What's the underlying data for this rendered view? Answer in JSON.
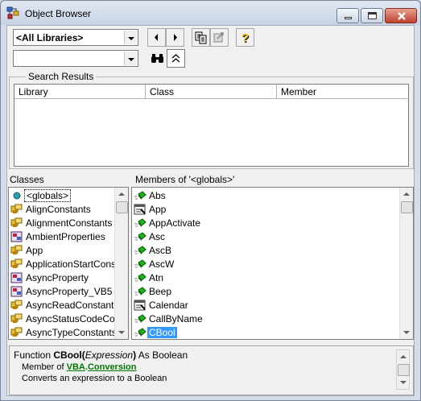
{
  "window": {
    "title": "Object Browser"
  },
  "toolbar": {
    "library_combo": "<All Libraries>",
    "search_combo": "",
    "buttons": [
      "back-icon",
      "forward-icon",
      "copy-icon",
      "view-definition-icon",
      "help-icon",
      "search-binoculars-icon",
      "collapse-results-icon"
    ]
  },
  "search_results": {
    "label": "Search Results",
    "columns": [
      "Library",
      "Class",
      "Member"
    ]
  },
  "classes": {
    "label": "Classes",
    "items": [
      {
        "label": "<globals>",
        "icon": "globals-icon"
      },
      {
        "label": "AlignConstants",
        "icon": "enum-icon"
      },
      {
        "label": "AlignmentConstants",
        "icon": "enum-icon"
      },
      {
        "label": "AmbientProperties",
        "icon": "class-icon"
      },
      {
        "label": "App",
        "icon": "enum-icon"
      },
      {
        "label": "ApplicationStartCons",
        "icon": "enum-icon"
      },
      {
        "label": "AsyncProperty",
        "icon": "class-icon"
      },
      {
        "label": "AsyncProperty_VB5",
        "icon": "class-icon"
      },
      {
        "label": "AsyncReadConstant",
        "icon": "enum-icon"
      },
      {
        "label": "AsyncStatusCodeCo",
        "icon": "enum-icon"
      },
      {
        "label": "AsyncTypeConstants",
        "icon": "enum-icon"
      }
    ]
  },
  "members": {
    "label": "Members of '<globals>'",
    "items": [
      {
        "label": "Abs",
        "icon": "method-icon"
      },
      {
        "label": "App",
        "icon": "property-icon"
      },
      {
        "label": "AppActivate",
        "icon": "method-icon"
      },
      {
        "label": "Asc",
        "icon": "method-icon"
      },
      {
        "label": "AscB",
        "icon": "method-icon"
      },
      {
        "label": "AscW",
        "icon": "method-icon"
      },
      {
        "label": "Atn",
        "icon": "method-icon"
      },
      {
        "label": "Beep",
        "icon": "method-icon"
      },
      {
        "label": "Calendar",
        "icon": "property-icon"
      },
      {
        "label": "CallByName",
        "icon": "method-icon"
      },
      {
        "label": "CBool",
        "icon": "method-icon"
      }
    ],
    "selected": "CBool"
  },
  "detail": {
    "func_prefix": "Function ",
    "func_name": "CBool",
    "paren_open": "(",
    "param": "Expression",
    "paren_close": ")",
    "func_suffix": " As Boolean",
    "member_of": "Member of ",
    "library_link": "VBA",
    "dot": ".",
    "module_link": "Conversion",
    "description": "Converts an expression to a Boolean"
  },
  "colors": {
    "selection": "#3399ff",
    "link": "#007700"
  }
}
